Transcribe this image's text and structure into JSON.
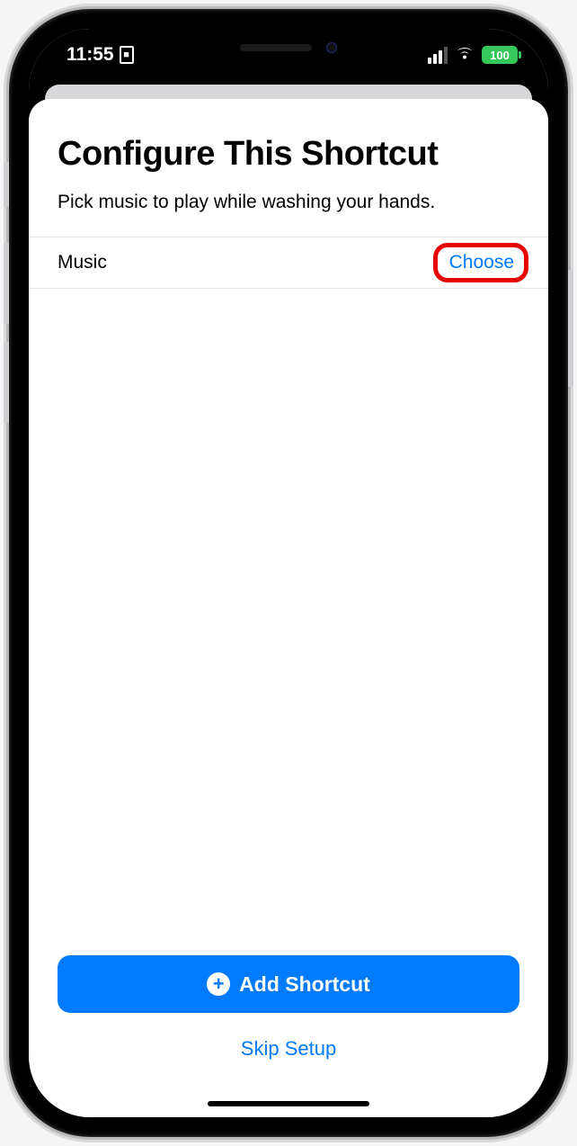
{
  "status_bar": {
    "time": "11:55",
    "battery_level": "100"
  },
  "sheet": {
    "title": "Configure This Shortcut",
    "subtitle": "Pick music to play while washing your hands.",
    "row": {
      "label": "Music",
      "action": "Choose"
    },
    "primary_button": "Add Shortcut",
    "secondary_button": "Skip Setup"
  }
}
